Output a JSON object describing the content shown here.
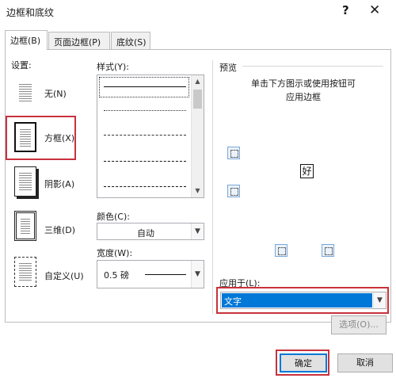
{
  "window": {
    "title": "边框和底纹",
    "help_glyph": "?",
    "close_glyph": "✕"
  },
  "tabs": [
    {
      "label": "边框(B)",
      "active": true
    },
    {
      "label": "页面边框(P)",
      "active": false
    },
    {
      "label": "底纹(S)",
      "active": false
    }
  ],
  "settings": {
    "label": "设置:",
    "items": [
      {
        "label": "无(N)",
        "selected": false
      },
      {
        "label": "方框(X)",
        "selected": true
      },
      {
        "label": "阴影(A)",
        "selected": false
      },
      {
        "label": "三维(D)",
        "selected": false
      },
      {
        "label": "自定义(U)",
        "selected": false
      }
    ]
  },
  "style": {
    "label": "样式(Y):"
  },
  "color": {
    "label": "颜色(C):",
    "value": "自动"
  },
  "width": {
    "label": "宽度(W):",
    "value": "0.5 磅"
  },
  "preview": {
    "label": "预览",
    "hint": "单击下方图示或使用按钮可\n应用边框",
    "sample_text": "好"
  },
  "apply_to": {
    "label": "应用于(L):",
    "value": "文字"
  },
  "buttons": {
    "options": "选项(O)...",
    "ok": "确定",
    "cancel": "取消"
  },
  "colors": {
    "accent_red": "#c8323c",
    "selection_blue": "#0078d7"
  }
}
